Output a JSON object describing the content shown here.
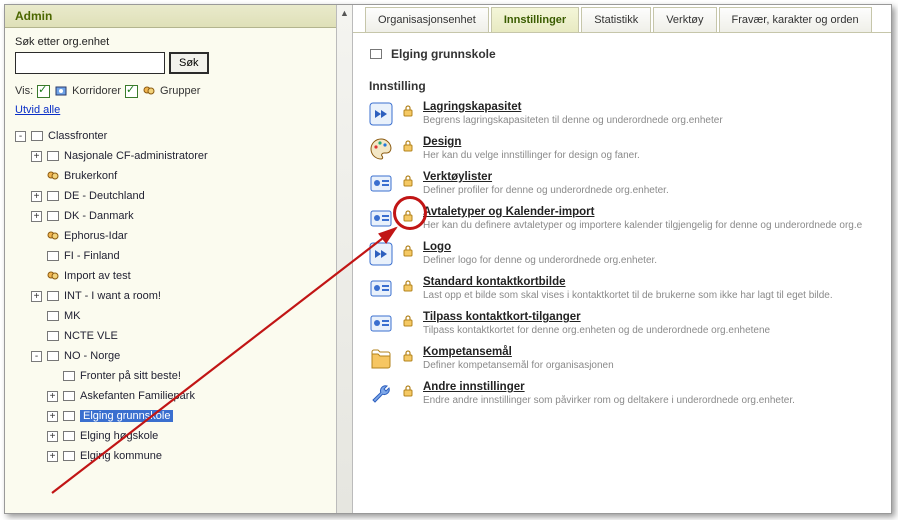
{
  "sidebar": {
    "title": "Admin",
    "search_label": "Søk etter org.enhet",
    "search_button": "Søk",
    "vis_label": "Vis:",
    "korridorer_label": "Korridorer",
    "grupper_label": "Grupper",
    "expand_all": "Utvid alle"
  },
  "tree": [
    {
      "level": 1,
      "exp": "-",
      "type": "folder",
      "label": "Classfronter"
    },
    {
      "level": 2,
      "exp": "+",
      "type": "folder",
      "label": "Nasjonale CF-administratorer"
    },
    {
      "level": 2,
      "exp": "",
      "type": "group",
      "label": "Brukerkonf"
    },
    {
      "level": 2,
      "exp": "+",
      "type": "folder",
      "label": "DE - Deutchland"
    },
    {
      "level": 2,
      "exp": "+",
      "type": "folder",
      "label": "DK - Danmark"
    },
    {
      "level": 2,
      "exp": "",
      "type": "group",
      "label": "Ephorus-Idar"
    },
    {
      "level": 2,
      "exp": "",
      "type": "folder",
      "label": "FI - Finland"
    },
    {
      "level": 2,
      "exp": "",
      "type": "group",
      "label": "Import av test"
    },
    {
      "level": 2,
      "exp": "+",
      "type": "folder",
      "label": "INT - I want a room!"
    },
    {
      "level": 2,
      "exp": "",
      "type": "folder",
      "label": "MK"
    },
    {
      "level": 2,
      "exp": "",
      "type": "folder",
      "label": "NCTE VLE"
    },
    {
      "level": 2,
      "exp": "-",
      "type": "folder",
      "label": "NO - Norge"
    },
    {
      "level": 3,
      "exp": "",
      "type": "folder",
      "label": "Fronter på sitt beste!"
    },
    {
      "level": 3,
      "exp": "+",
      "type": "folder",
      "label": "Askefanten Familiepark"
    },
    {
      "level": 3,
      "exp": "+",
      "type": "folder",
      "label": "Elging grunnskole",
      "selected": true
    },
    {
      "level": 3,
      "exp": "+",
      "type": "folder",
      "label": "Elging høgskole"
    },
    {
      "level": 3,
      "exp": "+",
      "type": "folder",
      "label": "Elging kommune"
    }
  ],
  "tabs": [
    {
      "label": "Organisasjonsenhet",
      "active": false
    },
    {
      "label": "Innstillinger",
      "active": true
    },
    {
      "label": "Statistikk",
      "active": false
    },
    {
      "label": "Verktøy",
      "active": false
    },
    {
      "label": "Fravær, karakter og orden",
      "active": false
    }
  ],
  "main": {
    "org_title": "Elging grunnskole",
    "section_heading": "Innstilling",
    "settings": [
      {
        "icon": "arrow",
        "title": "Lagringskapasitet",
        "desc": "Begrens lagringskapasiteten til denne og underordnede org.enheter"
      },
      {
        "icon": "palette",
        "title": "Design",
        "desc": "Her kan du velge innstillinger for design og faner."
      },
      {
        "icon": "card",
        "title": "Verktøylister",
        "desc": "Definer profiler for denne og underordnede org.enheter."
      },
      {
        "icon": "card",
        "title": "Avtaletyper og Kalender-import",
        "desc": "Her kan du definere avtaletyper og importere kalender tilgjengelig for denne og underordnede org.e"
      },
      {
        "icon": "arrow",
        "title": "Logo",
        "desc": "Definer logo for denne og underordnede org.enheter."
      },
      {
        "icon": "card",
        "title": "Standard kontaktkortbilde",
        "desc": "Last opp et bilde som skal vises i kontaktkortet til de brukerne som ikke har lagt til eget bilde."
      },
      {
        "icon": "card",
        "title": "Tilpass kontaktkort-tilganger",
        "desc": "Tilpass kontaktkortet for denne org.enheten og de underordnede org.enhetene"
      },
      {
        "icon": "folder",
        "title": "Kompetansemål",
        "desc": "Definer kompetansemål for organisasjonen"
      },
      {
        "icon": "wrench",
        "title": "Andre innstillinger",
        "desc": "Endre andre innstillinger som påvirker rom og deltakere i underordnede org.enheter."
      }
    ]
  }
}
